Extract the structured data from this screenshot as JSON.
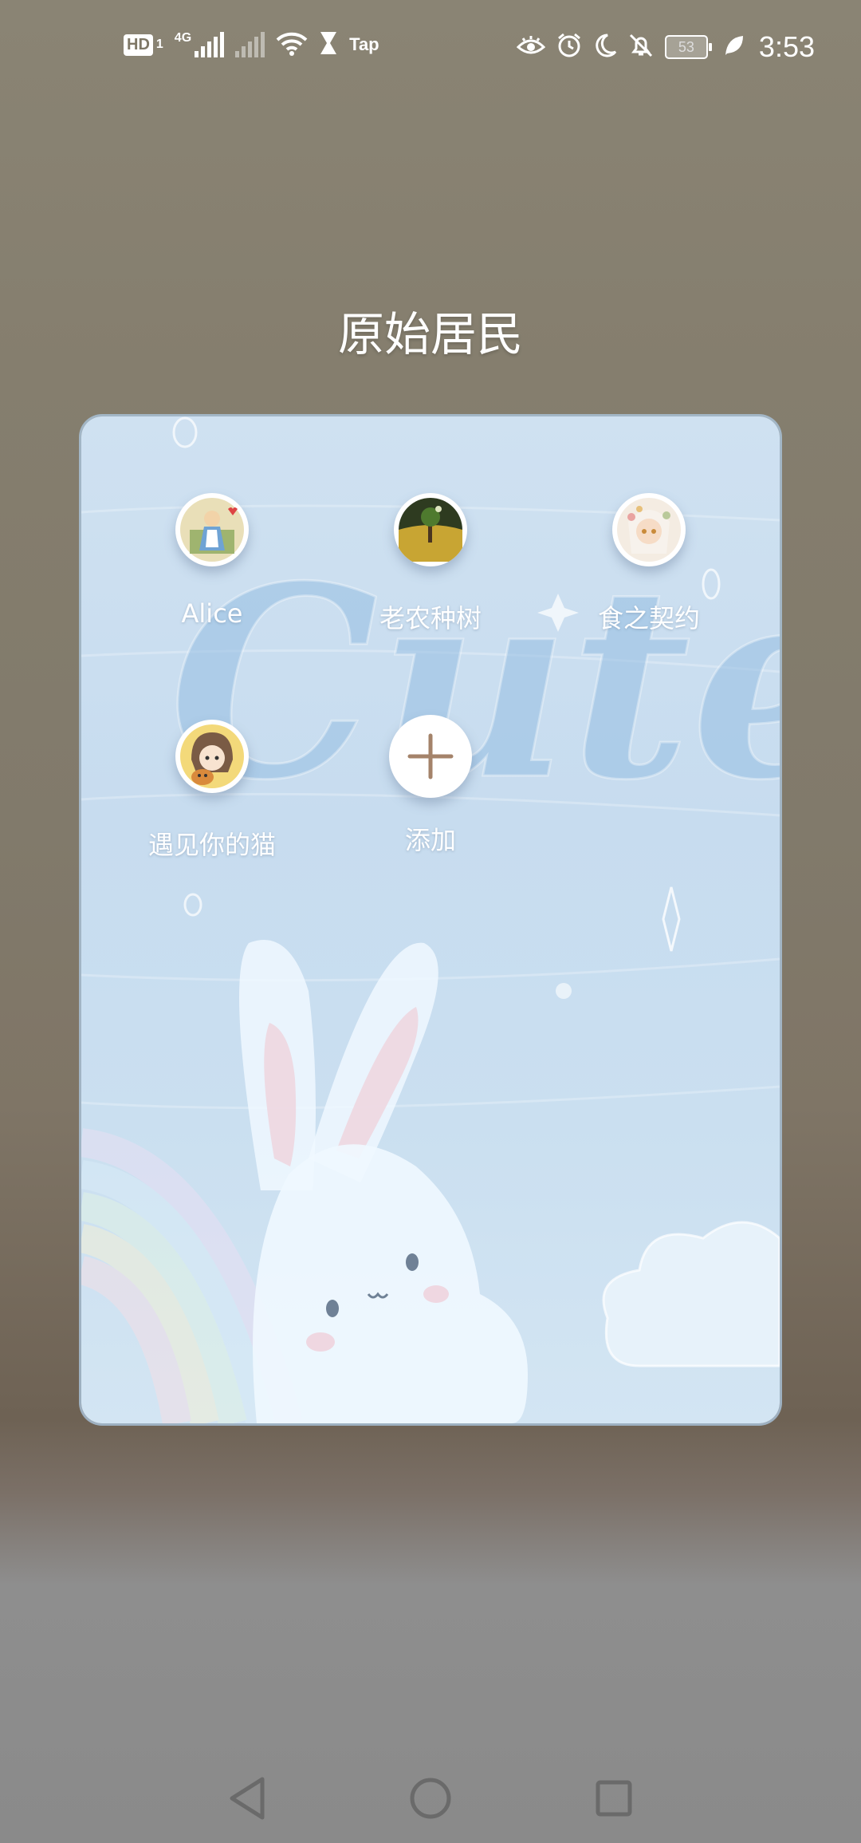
{
  "status_bar": {
    "hd_label": "HD",
    "sim_slot": "1",
    "network_type": "4G",
    "tap_label": "Tap",
    "battery_level": "53",
    "time": "3:53"
  },
  "folder": {
    "title": "原始居民",
    "wallpaper_text": "Cute",
    "apps": [
      {
        "label": "Alice"
      },
      {
        "label": "老农种树"
      },
      {
        "label": "食之契约"
      },
      {
        "label": "遇见你的猫"
      }
    ],
    "add_label": "添加"
  },
  "navigation": {
    "back_icon": "triangle-back-icon",
    "home_icon": "circle-home-icon",
    "recents_icon": "square-recents-icon"
  }
}
